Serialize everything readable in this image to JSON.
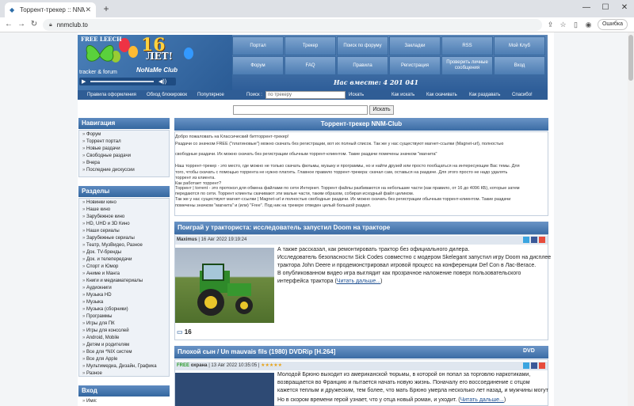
{
  "browser": {
    "tab_title": "Торрент-трекер :: NNM-Club",
    "tab_close": "✕",
    "new_tab": "+",
    "url": "nnmclub.to",
    "error_button": "Ошибка",
    "win_min": "—",
    "win_max": "☐",
    "win_close": "✕"
  },
  "header": {
    "free_leech": "FREE LEECH",
    "tracker_forum": "tracker & forum",
    "big16": "16",
    "let": "ЛЕТ!",
    "nname": "NoNaMe Club",
    "online": "Нас вместе: 4 201 041",
    "menu": [
      "Портал",
      "Трекер",
      "Поиск по форуму",
      "Закладки",
      "RSS",
      "Мой Клуб",
      "Форум",
      "FAQ",
      "Правила",
      "Регистрация",
      "Проверить личные сообщения",
      "Вход"
    ]
  },
  "subbar": {
    "rules": "Правила оформления",
    "bypass": "Обход блокировок",
    "popular": "Популярное",
    "search_label": "Поиск :",
    "search_placeholder": "по трекеру",
    "search_btn": "Искать",
    "how_search": "Как искать",
    "how_download": "Как скачивать",
    "how_seed": "Как раздавать",
    "thanks": "Спасибо!"
  },
  "search2_btn": "Искать",
  "sidebar": {
    "nav_title": "Навигация",
    "nav_items": [
      "Форум",
      "Торрент портал",
      "Новые раздачи",
      "Свободные раздачи",
      "Вчера",
      "Последние дискуссии"
    ],
    "sections_title": "Разделы",
    "section_items": [
      "Новинки кино",
      "Наше кино",
      "Зарубежное кино",
      "HD, UHD и 3D Кино",
      "Наши сериалы",
      "Зарубежные сериалы",
      "Театр, МузВидео, Разное",
      "Док. TV-бренды",
      "Док. и телепередачи",
      "Спорт и Юмор",
      "Аниме и Манга",
      "Книги и медиаматериалы",
      "Аудиокниги",
      "Музыка HD",
      "Музыка",
      "Музыка (сборники)",
      "Программы",
      "Игры для ПК",
      "Игры для консолей",
      "Android, Mobile",
      "Детям и родителям",
      "Все для *NIX систем",
      "Все для Apple",
      "Мультимедиа, Дизайн, Графика",
      "Разное"
    ],
    "login_title": "Вход",
    "login_name": "Имя:"
  },
  "welcome": {
    "title": "Торрент-трекер NNM-Club",
    "lines": [
      "Добро пожаловать на Классический битторрент-трекер!",
      "Раздачи со значком FREE (\"платиновые\") можно скачать без регистрации, вот их полный список. Так же у нас существуют магнет-ссылки (Magnet-url), полностью",
      "свободные раздачи. Их можно скачать без регистрации обычным торрент-клиентом. Такие раздачи помечены значком \"магнита\"",
      "Наш торрент-трекер - это место, где можно не только скачать фильмы, музыку и программы, но и найти друзей или просто пообщаться на интересующие Вас темы. Для",
      "того, чтобы скачать с помощью торрента не нужно платить. Главное правило торрент-трекера: скачал сам, оставься на раздаче. Для этого просто не надо удалять",
      "торрент из клиента.",
      "Как работает торрент?",
      "Торрент | torrent - это протокол для обмена файлами по сети Интернет. Торрент файлы разбиваются на небольшие части (как правило, от 16 до 4096 КБ), которые затем",
      "передаются по сети. Торрент клиенты скачивают эти малые части, таким образом, собирая исходный файл целиком.",
      "Так же у нас существуют магнет-ссылки | Magnet-url и полностью свободные раздачи. Их можно скачать без регистрации обычным торрент-клиентом. Такие раздачи",
      "помечены значком \"магнита\" и (или) \"Free\". Под ник на трекере отведен целый большой раздел."
    ]
  },
  "article1": {
    "title": "Поиграй у трактористa: исследователь запустил Doom на тракторе",
    "author": "Maximus",
    "date": "| 16 Авг 2022 19:19:24",
    "lines": [
      "А также рассказал, как ремонтировать трактор без официального дилера.",
      "Исследователь безопасности Sick Codes совместно с модером Skelegant запустил игру Doom на дисплее",
      "трактора John Deere и продемонстрировал игровой процесс на конференции Def Con в Лас-Вегасе.",
      "В опубликованном видео игра выглядит как прозрачное наложение поверх пользовательского",
      "интерфейса трактора ("
    ],
    "read_more": "Читать дальше...",
    "comments": "16"
  },
  "article2": {
    "title": "Плохой сын / Un mauvais fils (1980) DVDRip [H.264]",
    "free_badge": "FREE",
    "author": "охрана",
    "date": "| 13 Авг 2022 10:35:05 |",
    "stars": "★★★★★",
    "lines": [
      "Молодой Брюно выходит из американской тюрьмы, в которой он попал за торговлю наркотиками,",
      "возвращается во Францию и пытается начать новую жизнь. Поначалу его воссоединение с отцом",
      "кажется теплым и дружеским, тем более, что мать Брюно умерла несколько лет назад, и мужчины могут",
      "Но в скором времени герой узнает, что у отца новый роман, и уходит. ("
    ],
    "read_more": "Читать дальше..."
  },
  "colors": {
    "header_blue": "#2e5e99",
    "accent": "#3b6ca5",
    "link": "#1d4f91"
  }
}
